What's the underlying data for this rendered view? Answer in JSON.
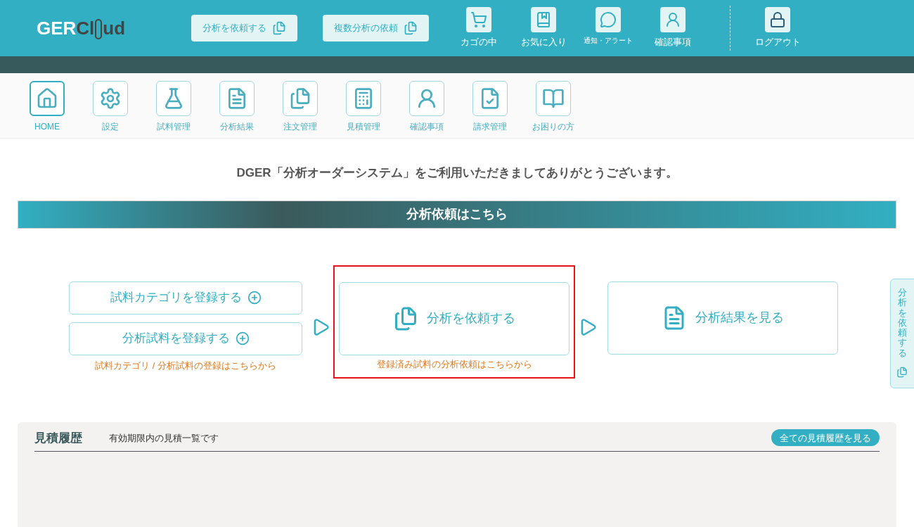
{
  "header": {
    "logo": {
      "prefix": "GER",
      "suffix": "Cl",
      "rest": "ud"
    },
    "buttons": [
      "分析を依頼する",
      "複数分析の依頼"
    ],
    "icons": [
      {
        "kind": "cart",
        "label": "カゴの中",
        "small": false
      },
      {
        "kind": "favorite",
        "label": "お気に入り",
        "small": false
      },
      {
        "kind": "chat",
        "label": "通知・アラート",
        "small": true
      },
      {
        "kind": "alert",
        "label": "確認事項",
        "small": false
      }
    ],
    "logout": {
      "kind": "lock",
      "label": "ログアウト"
    }
  },
  "nav": [
    {
      "kind": "home",
      "label": "HOME",
      "selected": true
    },
    {
      "kind": "gear",
      "label": "設定",
      "selected": false
    },
    {
      "kind": "flask",
      "label": "試料管理",
      "selected": false
    },
    {
      "kind": "result",
      "label": "分析結果",
      "selected": false
    },
    {
      "kind": "docs",
      "label": "注文管理",
      "selected": false
    },
    {
      "kind": "calc",
      "label": "見積管理",
      "selected": false
    },
    {
      "kind": "alert",
      "label": "確認事項",
      "selected": false
    },
    {
      "kind": "check",
      "label": "請求管理",
      "selected": false
    },
    {
      "kind": "guide",
      "label": "お困りの方",
      "selected": false
    }
  ],
  "welcome": "DGER「分析オーダーシステム」をご利用いただきましてありがとうございます。",
  "banner": "分析依頼はこちら",
  "register": {
    "buttons": [
      "試料カテゴリを登録する",
      "分析試料を登録する"
    ],
    "caption": "試料カテゴリ / 分析試料の登録はこちらから"
  },
  "request": {
    "label": "分析を依頼する",
    "caption": "登録済み試料の分析依頼はこちらから",
    "highlighted": true
  },
  "results": {
    "label": "分析結果を見る"
  },
  "side_tab": {
    "label": "分析を依頼する"
  },
  "quotes": {
    "title": "見積履歴",
    "subtitle": "有効期限内の見積一覧です",
    "button": "全ての見積履歴を見る"
  }
}
